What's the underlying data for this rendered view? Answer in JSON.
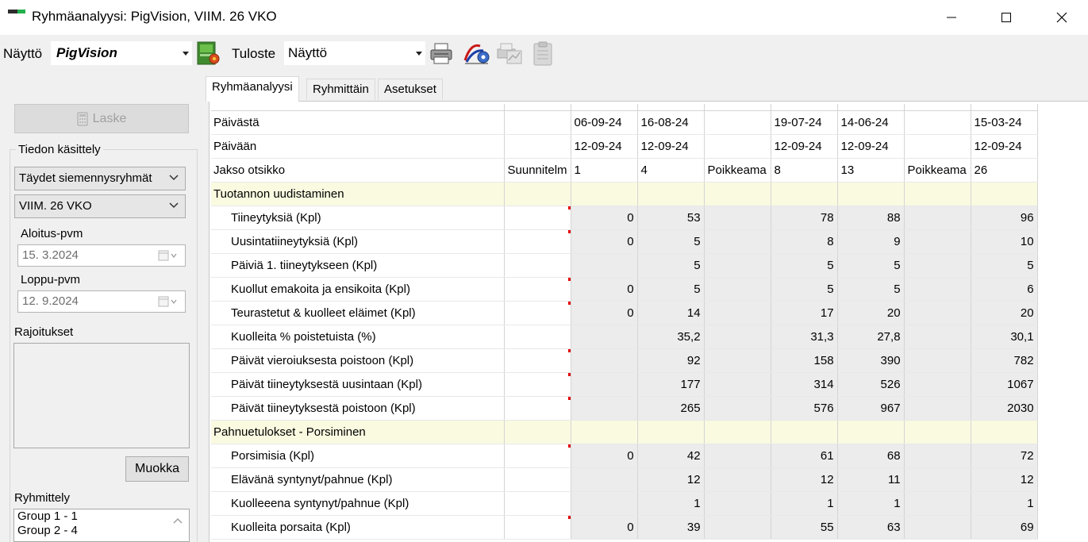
{
  "window": {
    "title": "Ryhmäanalyysi: PigVision, VIIM. 26 VKO"
  },
  "toolbar": {
    "nayto_label": "Näyttö",
    "nayto_value": "PigVision",
    "tuloste_label": "Tuloste",
    "tuloste_value": "Näyttö",
    "icons": [
      "report-run-icon",
      "printer-icon",
      "chart-settings-icon",
      "print-chart-icon",
      "clipboard-icon"
    ]
  },
  "left": {
    "laske_label": "Laske",
    "tiedon_label": "Tiedon käsittely",
    "mode_value": "Täydet siemennysryhmät",
    "period_value": "VIIM. 26 VKO",
    "start_label": "Aloitus-pvm",
    "start_value": "15.  3.2024",
    "end_label": "Loppu-pvm",
    "end_value": "12.  9.2024",
    "restrictions_label": "Rajoitukset",
    "muokka_label": "Muokka",
    "grouping_label": "Ryhmittely",
    "grouping_items": [
      "Group 1 - 1",
      "Group 2 - 4"
    ]
  },
  "tabs": [
    "Ryhmäanalyysi",
    "Ryhmittäin",
    "Asetukset"
  ],
  "grid": {
    "header_rows": [
      {
        "label": "Päivästä",
        "cells": [
          "",
          "06-09-24",
          "16-08-24",
          "",
          "19-07-24",
          "14-06-24",
          "",
          "15-03-24"
        ]
      },
      {
        "label": "Päivään",
        "cells": [
          "",
          "12-09-24",
          "12-09-24",
          "",
          "12-09-24",
          "12-09-24",
          "",
          "12-09-24"
        ]
      },
      {
        "label": "Jakso otsikko",
        "cells": [
          "Suunnitelm",
          "1",
          "4",
          "Poikkeama",
          "8",
          "13",
          "Poikkeama",
          "26"
        ]
      }
    ],
    "sections": [
      {
        "title": "Tuotannon uudistaminen",
        "rows": [
          {
            "label": "Tiineytyksiä (Kpl)",
            "cells": [
              "",
              "0",
              "53",
              "",
              "78",
              "88",
              "",
              "96"
            ]
          },
          {
            "label": "Uusintatiineytyksiä (Kpl)",
            "cells": [
              "",
              "0",
              "5",
              "",
              "8",
              "9",
              "",
              "10"
            ]
          },
          {
            "label": "Päiviä 1. tiineytykseen (Kpl)",
            "cells": [
              "",
              "",
              "5",
              "",
              "5",
              "5",
              "",
              "5"
            ]
          },
          {
            "label": "Kuollut emakoita ja ensikoita (Kpl)",
            "cells": [
              "",
              "0",
              "5",
              "",
              "5",
              "5",
              "",
              "6"
            ]
          },
          {
            "label": "Teurastetut & kuolleet eläimet (Kpl)",
            "cells": [
              "",
              "0",
              "14",
              "",
              "17",
              "20",
              "",
              "20"
            ]
          },
          {
            "label": "Kuolleita % poistetuista (%)",
            "cells": [
              "",
              "",
              "35,2",
              "",
              "31,3",
              "27,8",
              "",
              "30,1"
            ]
          },
          {
            "label": "Päivät vieroiuksesta poistoon (Kpl)",
            "cells": [
              "",
              "",
              "92",
              "",
              "158",
              "390",
              "",
              "782"
            ]
          },
          {
            "label": "Päivät tiineytyksestä uusintaan (Kpl)",
            "cells": [
              "",
              "",
              "177",
              "",
              "314",
              "526",
              "",
              "1067"
            ]
          },
          {
            "label": "Päivät tiineytyksestä poistoon (Kpl)",
            "cells": [
              "",
              "",
              "265",
              "",
              "576",
              "967",
              "",
              "2030"
            ]
          }
        ]
      },
      {
        "title": "Pahnuetulokset - Porsiminen",
        "rows": [
          {
            "label": "Porsimisia (Kpl)",
            "cells": [
              "",
              "0",
              "42",
              "",
              "61",
              "68",
              "",
              "72"
            ]
          },
          {
            "label": "Elävänä syntynyt/pahnue (Kpl)",
            "cells": [
              "",
              "",
              "12",
              "",
              "12",
              "11",
              "",
              "12"
            ]
          },
          {
            "label": "Kuolleeena syntynyt/pahnue (Kpl)",
            "cells": [
              "",
              "",
              "1",
              "",
              "1",
              "1",
              "",
              "1"
            ]
          },
          {
            "label": "Kuolleita porsaita (Kpl)",
            "cells": [
              "",
              "0",
              "39",
              "",
              "55",
              "63",
              "",
              "69"
            ]
          }
        ]
      }
    ]
  }
}
